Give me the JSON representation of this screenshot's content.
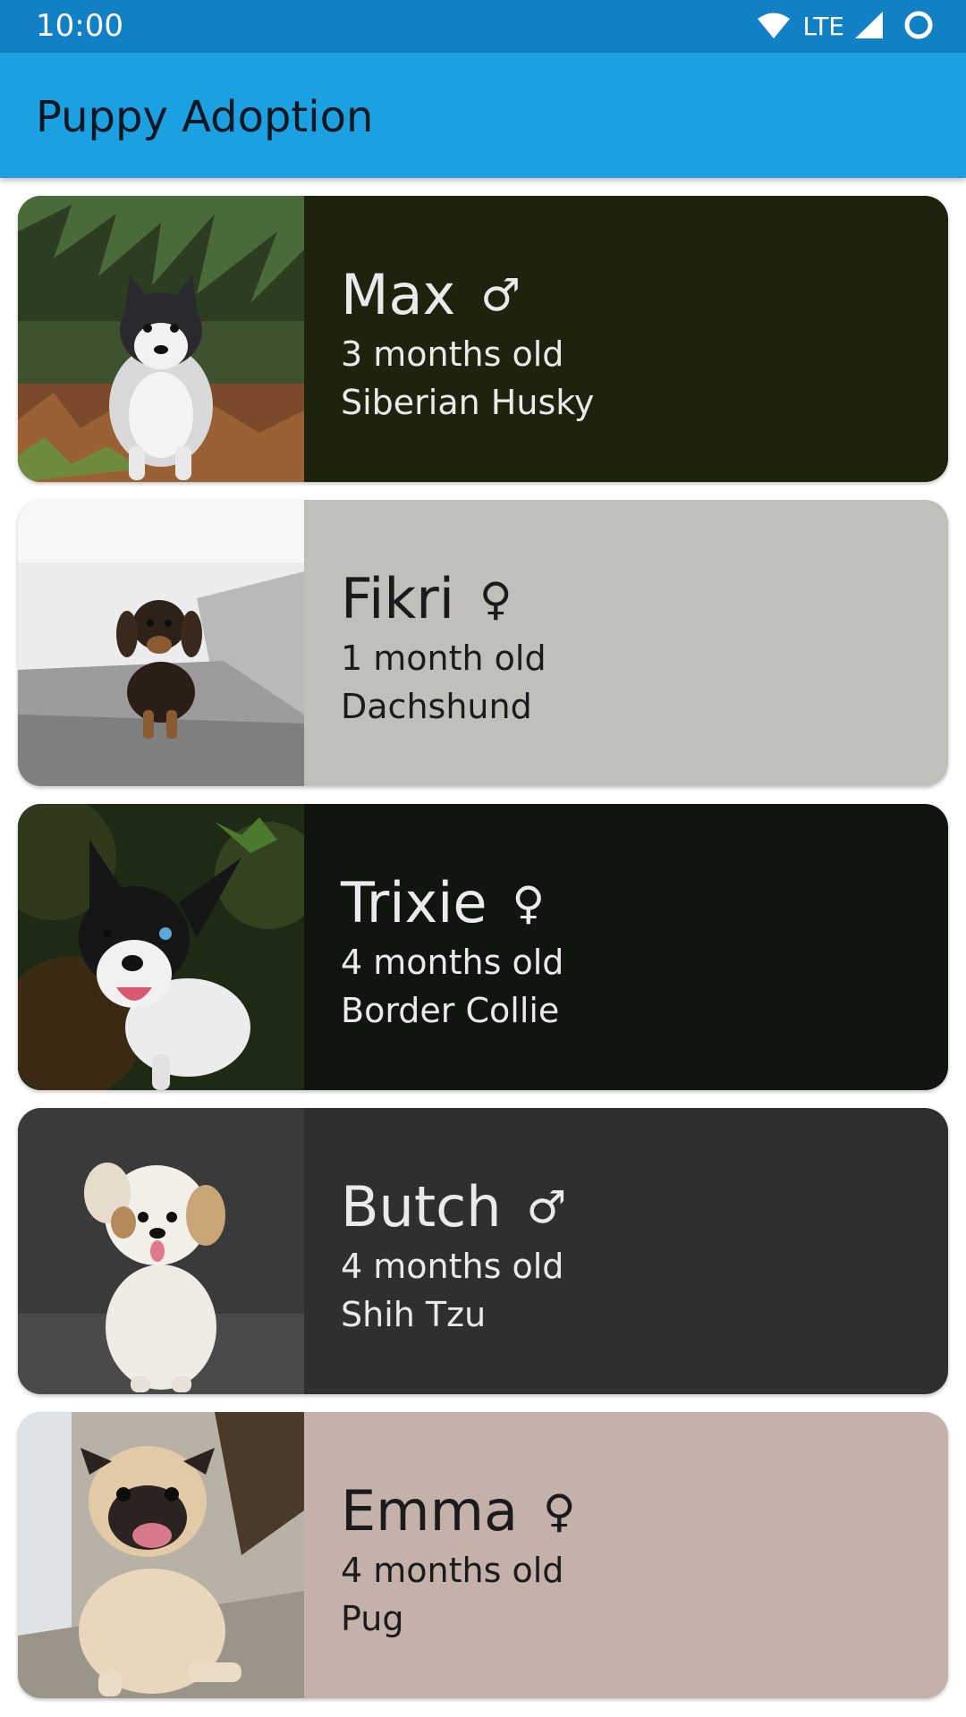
{
  "status_bar": {
    "time": "10:00",
    "network": "LTE",
    "icons": [
      "wifi-icon",
      "cell-signal-icon",
      "battery-circle-icon"
    ]
  },
  "app_bar": {
    "title": "Puppy Adoption",
    "background": "#1ba1e2"
  },
  "puppies": [
    {
      "name": "Max",
      "gender_symbol": "♂",
      "gender": "male",
      "age": "3 months old",
      "breed": "Siberian Husky",
      "card_color": "#1e230e",
      "text_color": "#eaeaea"
    },
    {
      "name": "Fikri",
      "gender_symbol": "♀",
      "gender": "female",
      "age": "1 month old",
      "breed": "Dachshund",
      "card_color": "#c1bfb9",
      "text_color": "#1b1b1b"
    },
    {
      "name": "Trixie",
      "gender_symbol": "♀",
      "gender": "female",
      "age": "4 months old",
      "breed": "Border Collie",
      "card_color": "#101510",
      "text_color": "#eaeaea"
    },
    {
      "name": "Butch",
      "gender_symbol": "♂",
      "gender": "male",
      "age": "4 months old",
      "breed": "Shih Tzu",
      "card_color": "#2f2f2f",
      "text_color": "#eaeaea"
    },
    {
      "name": "Emma",
      "gender_symbol": "♀",
      "gender": "female",
      "age": "4 months old",
      "breed": "Pug",
      "card_color": "#c4b1a9",
      "text_color": "#1b1b1b"
    }
  ]
}
